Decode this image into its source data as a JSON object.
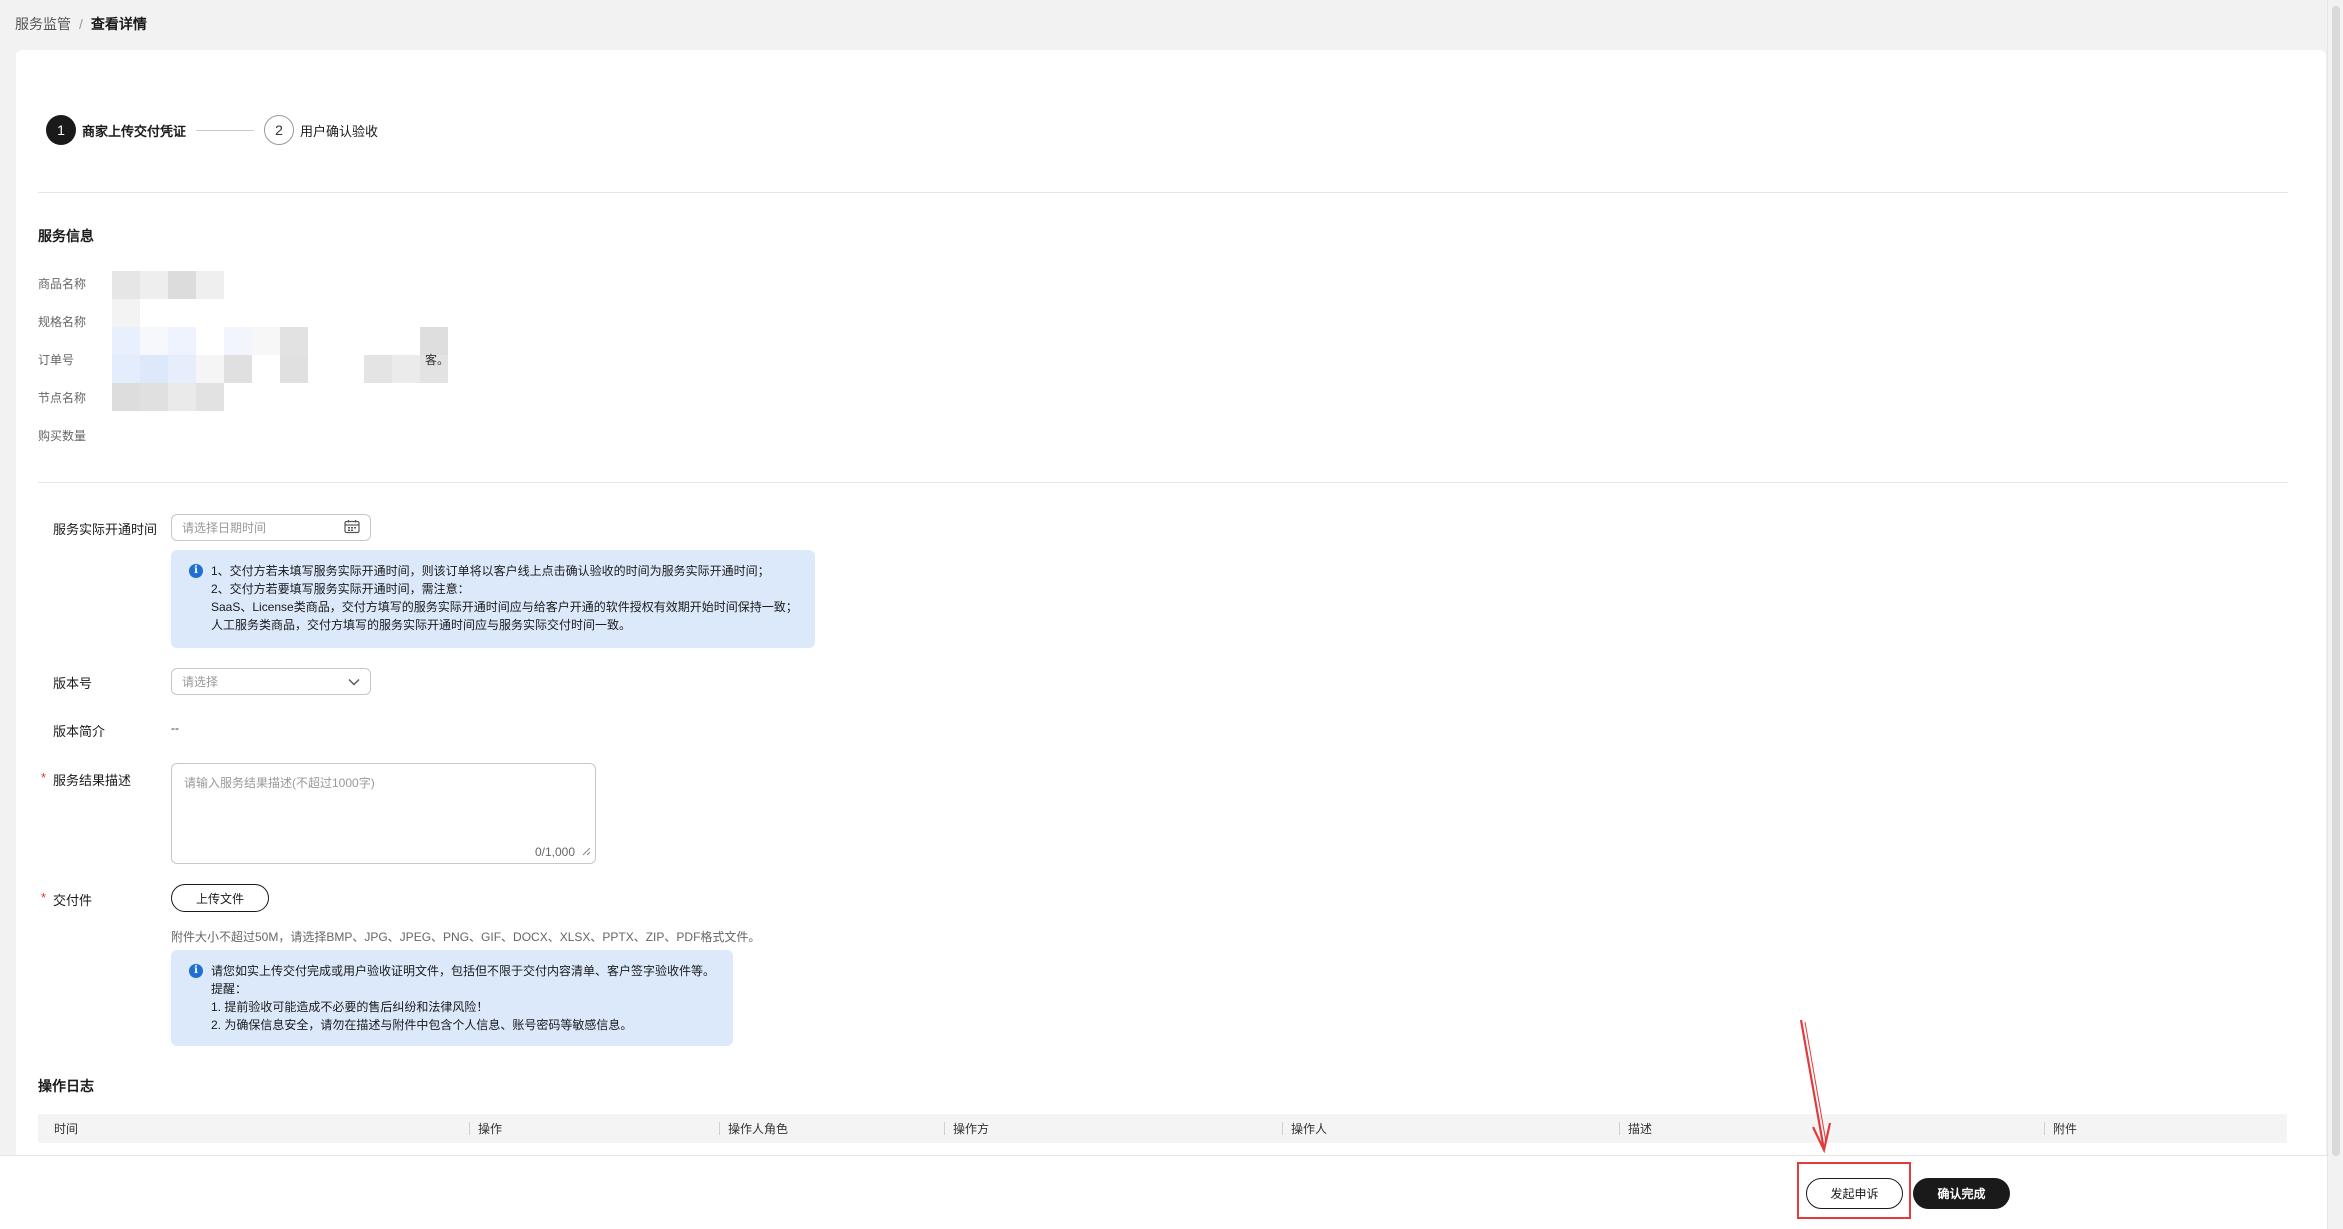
{
  "breadcrumb": {
    "parent": "服务监管",
    "separator": "/",
    "current": "查看详情"
  },
  "steps": [
    {
      "number": "1",
      "label": "商家上传交付凭证",
      "active": true
    },
    {
      "number": "2",
      "label": "用户确认验收",
      "active": false
    }
  ],
  "service_info": {
    "title": "服务信息",
    "labels": {
      "product_name": "商品名称",
      "spec_name": "规格名称",
      "order_no": "订单号",
      "node_name": "节点名称",
      "quantity": "购买数量"
    },
    "order_suffix": "客。"
  },
  "form": {
    "open_time": {
      "label": "服务实际开通时间",
      "placeholder": "请选择日期时间"
    },
    "open_time_notice": {
      "line1": "1、交付方若未填写服务实际开通时间，则该订单将以客户线上点击确认验收的时间为服务实际开通时间；",
      "line2": "2、交付方若要填写服务实际开通时间，需注意：",
      "line3": "SaaS、License类商品，交付方填写的服务实际开通时间应与给客户开通的软件授权有效期开始时间保持一致；",
      "line4": "人工服务类商品，交付方填写的服务实际开通时间应与服务实际交付时间一致。"
    },
    "version": {
      "label": "版本号",
      "placeholder": "请选择"
    },
    "version_desc": {
      "label": "版本简介",
      "value": "--"
    },
    "result_desc": {
      "required": "*",
      "label": "服务结果描述",
      "placeholder": "请输入服务结果描述(不超过1000字)",
      "counter": "0/1,000"
    },
    "deliverable": {
      "required": "*",
      "label": "交付件",
      "upload_button": "上传文件",
      "hint": "附件大小不超过50M，请选择BMP、JPG、JPEG、PNG、GIF、DOCX、XLSX、PPTX、ZIP、PDF格式文件。"
    },
    "deliverable_notice": {
      "line1": "请您如实上传交付完成或用户验收证明文件，包括但不限于交付内容清单、客户签字验收件等。",
      "line2": "提醒：",
      "line3": "1. 提前验收可能造成不必要的售后纠纷和法律风险！",
      "line4": "2. 为确保信息安全，请勿在描述与附件中包含个人信息、账号密码等敏感信息。"
    }
  },
  "operation_log": {
    "title": "操作日志",
    "columns": [
      "时间",
      "操作",
      "操作人角色",
      "操作方",
      "操作人",
      "描述",
      "附件"
    ]
  },
  "footer": {
    "complain_button": "发起申诉",
    "confirm_button": "确认完成"
  },
  "colors": {
    "primary": "#1a1a1a",
    "notice_bg": "#dbe9fb",
    "info_icon": "#1f6fd6",
    "required": "#e0312f",
    "annotation": "#e23b3b"
  }
}
